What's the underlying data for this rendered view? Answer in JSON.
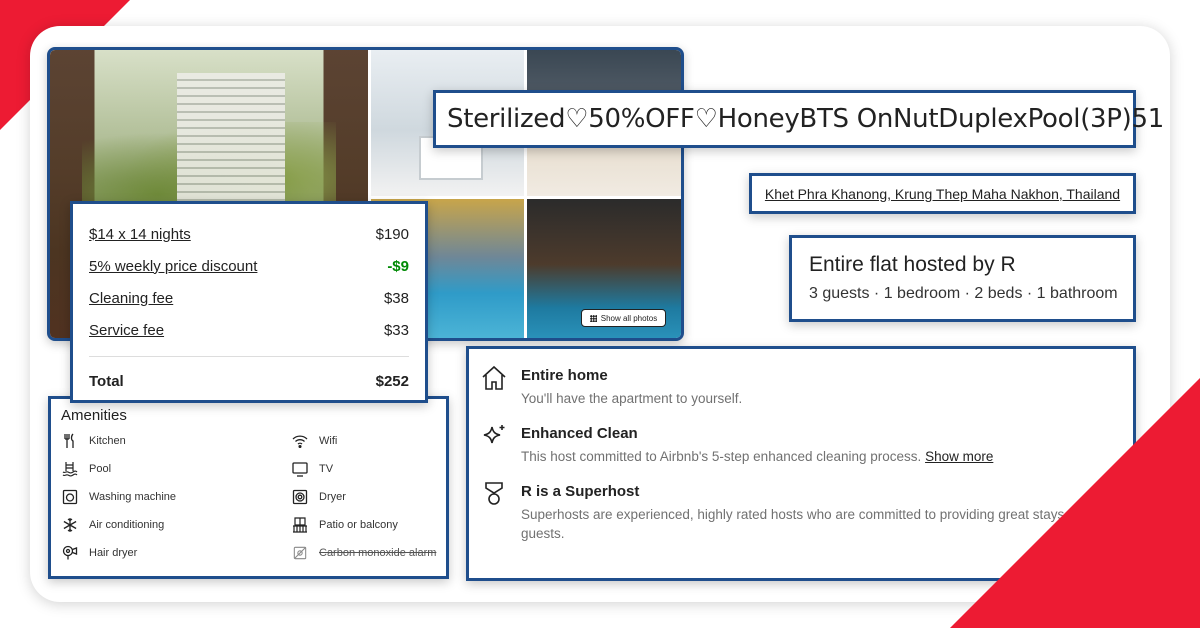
{
  "listing": {
    "title": "Sterilized♡50%OFF♡HoneyBTS OnNutDuplexPool(3P)51",
    "location": "Khet Phra Khanong, Krung Thep Maha Nakhon, Thailand",
    "host_title": "Entire flat hosted by R",
    "host_details": "3 guests · 1 bedroom · 2 beds · 1 bathroom"
  },
  "gallery": {
    "show_all_label": "Show all photos",
    "icon": "grid-icon"
  },
  "price": {
    "rows": [
      {
        "label": "$14 x 14 nights",
        "value": "$190"
      },
      {
        "label": "5% weekly price discount",
        "value": "-$9"
      },
      {
        "label": "Cleaning fee",
        "value": "$38"
      },
      {
        "label": "Service fee",
        "value": "$33"
      }
    ],
    "total_label": "Total",
    "total_value": "$252",
    "discount_color": "#008a05"
  },
  "amenities": {
    "title": "Amenities",
    "items": [
      {
        "label": "Kitchen",
        "icon": "kitchen-icon"
      },
      {
        "label": "Wifi",
        "icon": "wifi-icon"
      },
      {
        "label": "Pool",
        "icon": "pool-icon"
      },
      {
        "label": "TV",
        "icon": "tv-icon"
      },
      {
        "label": "Washing machine",
        "icon": "washing-machine-icon"
      },
      {
        "label": "Dryer",
        "icon": "dryer-icon"
      },
      {
        "label": "Air conditioning",
        "icon": "snowflake-icon"
      },
      {
        "label": "Patio or balcony",
        "icon": "balcony-icon"
      },
      {
        "label": "Hair dryer",
        "icon": "hair-dryer-icon"
      },
      {
        "label": "Carbon monoxide alarm",
        "icon": "alarm-icon",
        "unavailable": true
      }
    ]
  },
  "features": [
    {
      "title": "Entire home",
      "desc": "You'll have the apartment to yourself.",
      "icon": "home-icon"
    },
    {
      "title": "Enhanced Clean",
      "desc": "This host committed to Airbnb's 5-step enhanced cleaning process.",
      "link": "Show more",
      "icon": "sparkle-icon"
    },
    {
      "title": "R is a Superhost",
      "desc": "Superhosts are experienced, highly rated hosts who are committed to providing great stays for guests.",
      "icon": "superhost-medal-icon"
    }
  ],
  "colors": {
    "brand_red": "#ed1b33",
    "border_blue": "#1f4e8c"
  }
}
